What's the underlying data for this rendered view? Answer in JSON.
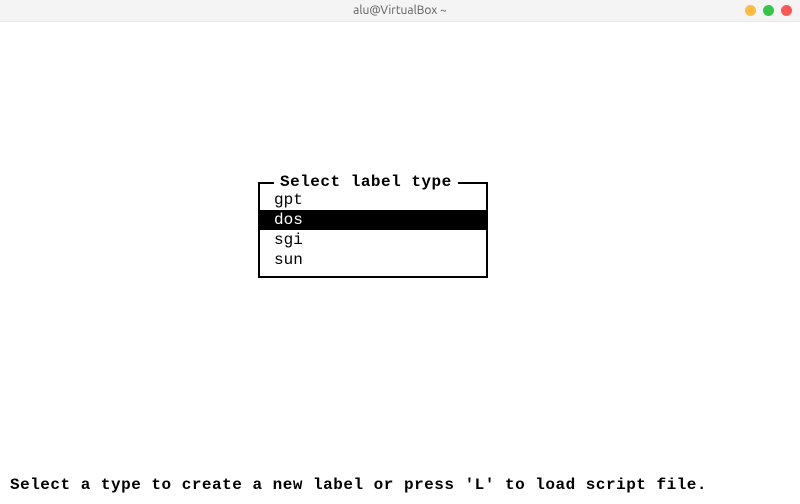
{
  "window": {
    "title": "alu@VirtualBox ~"
  },
  "dialog": {
    "title": "Select label type",
    "selected_index": 1,
    "items": [
      {
        "label": "gpt"
      },
      {
        "label": "dos"
      },
      {
        "label": "sgi"
      },
      {
        "label": "sun"
      }
    ]
  },
  "hint": "Select a type to create a new label or press 'L' to load script file."
}
